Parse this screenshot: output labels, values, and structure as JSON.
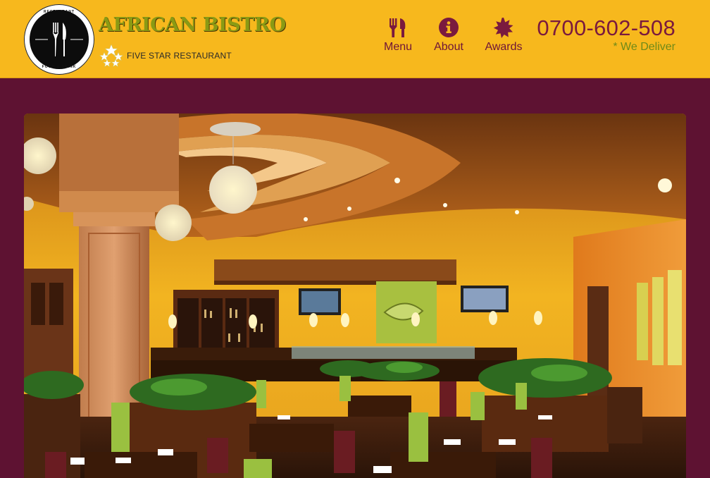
{
  "header": {
    "logo": {
      "ring_top": "RESTAURANT",
      "ring_bottom": "FOOD & DRINK",
      "icon": "fork-knife-icon"
    },
    "brand": "AFRICAN BISTRO",
    "tagline": "FIVE STAR RESTAURANT",
    "stars_icon": "star-cluster-icon",
    "nav": [
      {
        "label": "Menu",
        "icon": "fork-knife-icon"
      },
      {
        "label": "About",
        "icon": "info-circle-icon"
      },
      {
        "label": "Awards",
        "icon": "award-burst-icon"
      }
    ],
    "phone": "0700-602-508",
    "delivery": "* We Deliver"
  },
  "hero": {
    "image": "restaurant-interior-photo"
  },
  "colors": {
    "header_bg": "#f7b81d",
    "page_bg": "#5e1232",
    "brand_green": "#8a9a14",
    "nav_maroon": "#6e1538",
    "phone_maroon": "#7a1a3e"
  }
}
